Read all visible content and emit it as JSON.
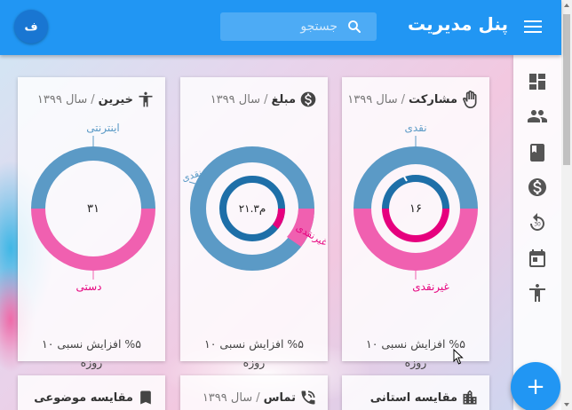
{
  "app": {
    "title": "پنل مدیریت",
    "search_placeholder": "جستجو",
    "avatar_initial": "ف",
    "fab_label": "+"
  },
  "rail": {
    "items": [
      {
        "icon": "dashboard-icon"
      },
      {
        "icon": "people-icon"
      },
      {
        "icon": "book-icon"
      },
      {
        "icon": "dollar-icon"
      },
      {
        "icon": "replay-30-icon"
      },
      {
        "icon": "calendar-icon"
      },
      {
        "icon": "accessibility-icon"
      }
    ]
  },
  "cards": [
    {
      "title": "مشارکت",
      "period": "سال ۱۳۹۹",
      "icon": "hand-icon",
      "center_value": "۱۶",
      "top_label": "نقدی",
      "bottom_label": "غیرنقدی",
      "footer_line1": "%۵ افزایش نسبی ۱۰",
      "footer_line2": "روزه"
    },
    {
      "title": "مبلغ",
      "period": "سال ۱۳۹۹",
      "icon": "dollar-icon",
      "center_value": "۲۱.۳م",
      "top_label": "نقدی",
      "bottom_label": "غیرنقدی",
      "footer_line1": "%۵ افزایش نسبی ۱۰",
      "footer_line2": "روزه"
    },
    {
      "title": "خیرین",
      "period": "سال ۱۳۹۹",
      "icon": "person-icon",
      "center_value": "۳۱",
      "top_label": "اینترنتی",
      "bottom_label": "دستی",
      "footer_line1": "%۵ افزایش نسبی ۱۰",
      "footer_line2": "روزه"
    }
  ],
  "bottom_cards": [
    {
      "title": "مقایسه استانی",
      "period": "",
      "icon": "city-icon"
    },
    {
      "title": "تماس",
      "period": "سال ۱۳۹۹",
      "icon": "phone-icon"
    },
    {
      "title": "مقایسه موضوعی",
      "period": "",
      "icon": "bookmark-icon"
    }
  ],
  "colors": {
    "primary": "#2196f3",
    "donut_blue": "#5b9ac6",
    "donut_dark_blue": "#1e6fa8",
    "donut_pink": "#f060b0",
    "donut_magenta": "#e6007e"
  }
}
